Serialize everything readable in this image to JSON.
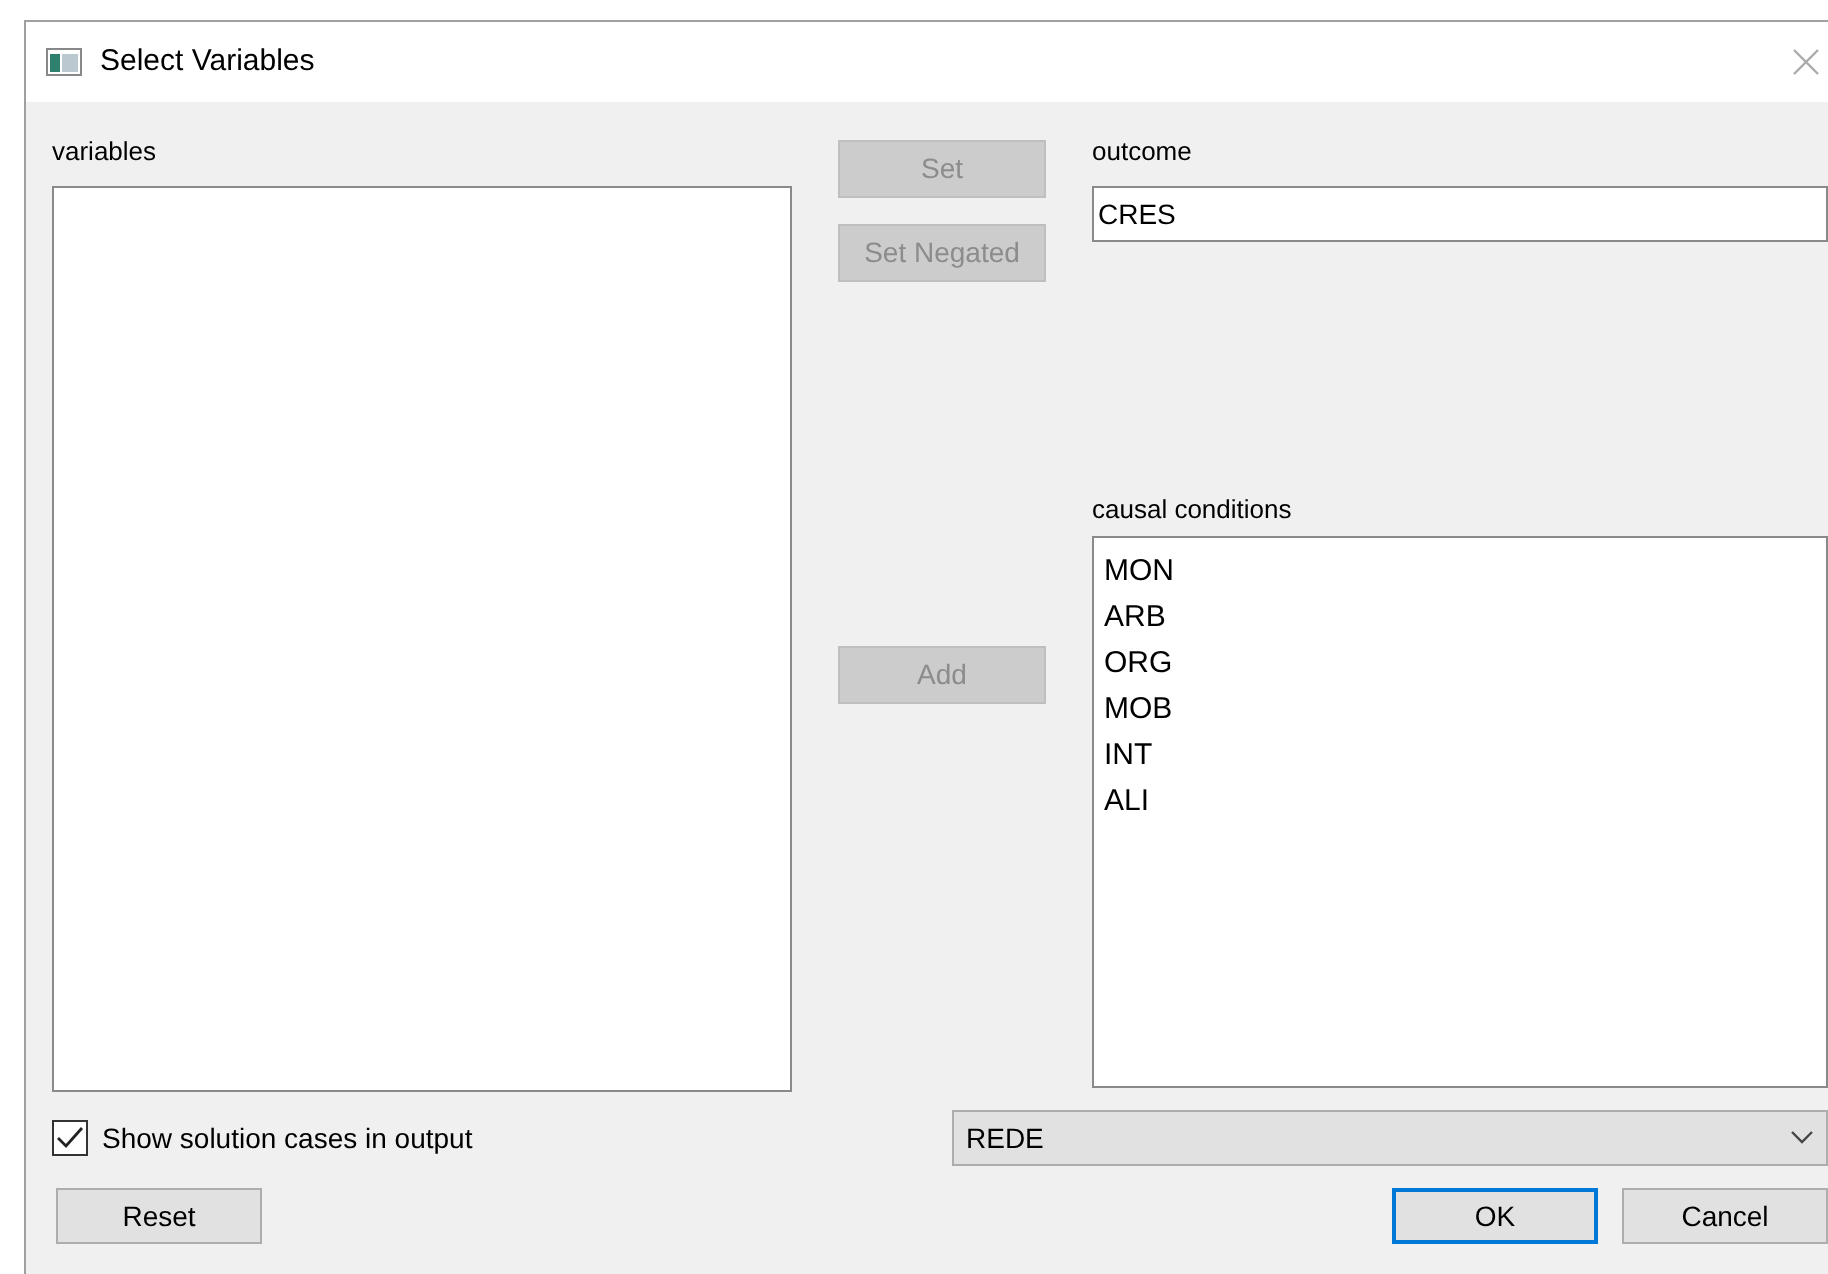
{
  "window": {
    "title": "Select Variables"
  },
  "variables": {
    "label": "variables"
  },
  "buttons": [
    {
      "label": "Set",
      "disabled": true
    },
    {
      "label": "Set Negated",
      "disabled": true
    },
    {
      "label": "Add",
      "disabled": true
    }
  ],
  "outcome": {
    "label": "outcome",
    "value": "CRES"
  },
  "causal_conditions": {
    "label": "causal conditions",
    "items": [
      "MON",
      "ARB",
      "ORG",
      "MOB",
      "INT",
      "ALI"
    ]
  },
  "show_solution_cases": {
    "label": "Show solution cases in output",
    "checked": true
  },
  "dataset": {
    "value": "REDE"
  },
  "footer_buttons": [
    {
      "label": "Reset",
      "kind": "plain"
    },
    {
      "label": "OK",
      "kind": "default"
    },
    {
      "label": "Cancel",
      "kind": "plain"
    }
  ]
}
